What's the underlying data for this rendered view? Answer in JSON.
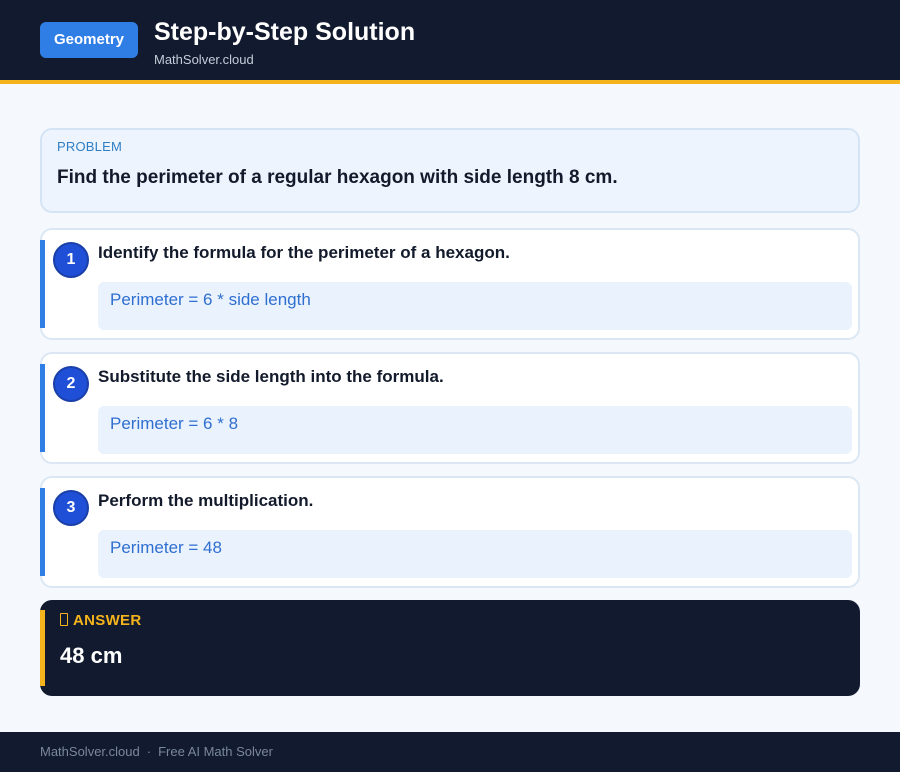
{
  "header": {
    "badge": "Geometry",
    "title": "Step-by-Step Solution",
    "site": "MathSolver.cloud"
  },
  "problem": {
    "label": "PROBLEM",
    "text": "Find the perimeter of a regular hexagon with side length 8 cm."
  },
  "steps": [
    {
      "number": "1",
      "title": "Identify the formula for the perimeter of a hexagon.",
      "formula": "Perimeter = 6 * side length"
    },
    {
      "number": "2",
      "title": "Substitute the side length into the formula.",
      "formula": "Perimeter = 6 * 8"
    },
    {
      "number": "3",
      "title": "Perform the multiplication.",
      "formula": "Perimeter = 48"
    }
  ],
  "answer": {
    "icon": "document-icon",
    "label": "ANSWER",
    "value": "48 cm"
  },
  "footer": {
    "site": "MathSolver.cloud",
    "separator": "·",
    "tagline": "Free AI Math Solver"
  },
  "colors": {
    "header_bg": "#111a2e",
    "accent_yellow": "#f6b41c",
    "accent_blue": "#2f7ee6",
    "page_bg": "#f5f8fc"
  }
}
